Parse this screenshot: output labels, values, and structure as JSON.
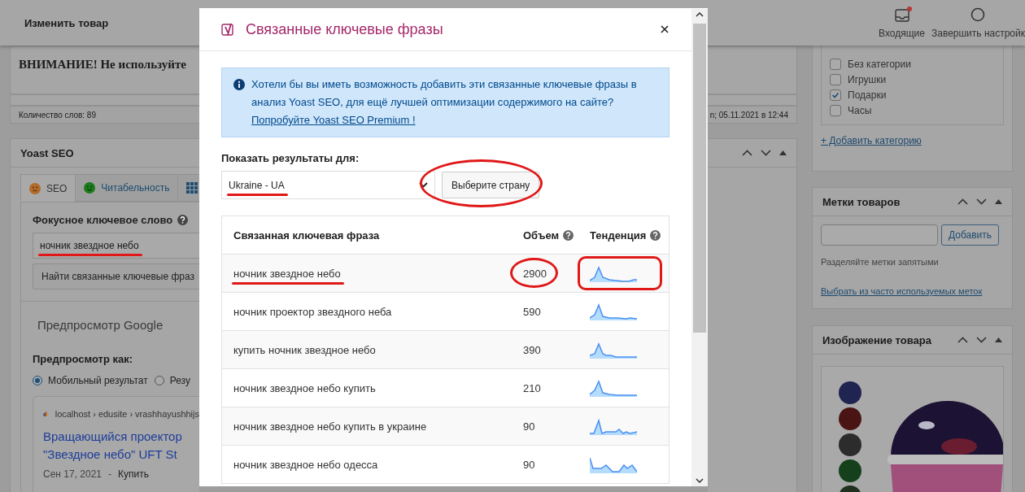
{
  "top_bar": {
    "title": "Изменить товар",
    "actions": [
      {
        "kind": "inbox",
        "label": "Входящие",
        "badge": true
      },
      {
        "kind": "setup",
        "label": "Завершить настройк",
        "badge": false
      }
    ]
  },
  "editor": {
    "notice": "ВНИМАНИЕ! Не используйте",
    "word_count": "Количество слов: 89",
    "last_edited": "n; 05.11.2021 в 12:44"
  },
  "yoast": {
    "title": "Yoast SEO",
    "tabs": [
      {
        "kind": "seo",
        "label": "SEO",
        "selected": true
      },
      {
        "kind": "readability",
        "label": "Читабельность",
        "selected": false
      },
      {
        "kind": "schema",
        "selected": false
      }
    ],
    "focus_label": "Фокусное ключевое слово",
    "focus_keyword": {
      "value": "ночник звездное небо",
      "underlined": true
    },
    "related_button": "Найти связанные ключевые фраз",
    "preview_title": "Предпросмотр Google",
    "preview_as_label": "Предпросмотр как:",
    "preview_modes": [
      {
        "label": "Мобильный результат",
        "selected": true
      },
      {
        "label": "Резу",
        "selected": false
      }
    ],
    "snippet": {
      "breadcrumb": "localhost › edusite › vrashhayushhijs",
      "title_lines": [
        "Вращающийся проектор",
        "\"Звездное небо\" UFT St"
      ],
      "date": "Сен 17, 2021",
      "separator": "-",
      "description": "Купить"
    }
  },
  "sidebar": {
    "categories": [
      {
        "label": "Без категории",
        "checked": false
      },
      {
        "label": "Игрушки",
        "checked": false
      },
      {
        "label": "Подарки",
        "checked": true
      },
      {
        "label": "Часы",
        "checked": false
      }
    ],
    "add_category": "+ Добавить категорию",
    "tags": {
      "title": "Метки товаров",
      "button": "Добавить",
      "hint": "Разделяйте метки запятыми",
      "choose_link": "Выбрать из часто используемых меток"
    },
    "image": {
      "title": "Изображение товара"
    }
  },
  "modal": {
    "title": "Связанные ключевые фразы",
    "notice": {
      "text": "Хотели бы вы иметь возможность добавить эти связанные ключевые фразы в анализ Yoast SEO, для ещё лучшей оптимизации содержимого на сайте?",
      "link": "Попробуйте Yoast SEO Premium !"
    },
    "country_label": "Показать результаты для:",
    "country_select": {
      "value": "Ukraine - UA",
      "underlined": true
    },
    "country_button": {
      "label": "Выберите страну",
      "circled": true
    },
    "table": {
      "columns": [
        {
          "label": "Связанная ключевая фраза",
          "help": false
        },
        {
          "label": "Объем",
          "help": true
        },
        {
          "label": "Тенденция",
          "help": true
        }
      ],
      "rows": [
        {
          "phrase": "ночник звездное небо",
          "volume": "2900",
          "phrase_underlined": true,
          "volume_circled": true,
          "trend_circled": true
        },
        {
          "phrase": "ночник проектор звездного неба",
          "volume": "590",
          "phrase_underlined": false,
          "volume_circled": false,
          "trend_circled": false
        },
        {
          "phrase": "купить ночник звездное небо",
          "volume": "390",
          "phrase_underlined": false,
          "volume_circled": false,
          "trend_circled": false
        },
        {
          "phrase": "ночник звездное небо купить",
          "volume": "210",
          "phrase_underlined": false,
          "volume_circled": false,
          "trend_circled": false
        },
        {
          "phrase": "ночник звездное небо купить в украине",
          "volume": "90",
          "phrase_underlined": false,
          "volume_circled": false,
          "trend_circled": false
        },
        {
          "phrase": "ночник звездное небо одесса",
          "volume": "90",
          "phrase_underlined": false,
          "volume_circled": false,
          "trend_circled": false
        }
      ]
    }
  }
}
